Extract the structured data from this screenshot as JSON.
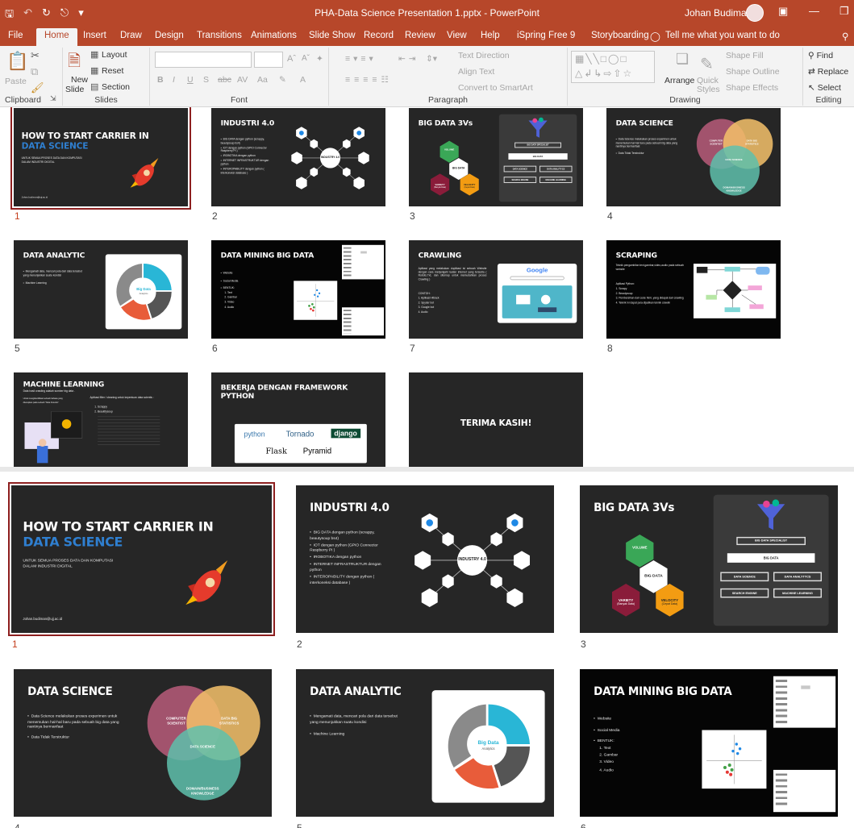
{
  "titlebar": {
    "document_title": "PHA-Data Science Presentation 1.pptx - PowerPoint",
    "user_name": "Johan Budiman",
    "qat_icons": [
      "save-icon",
      "undo-icon",
      "redo-icon",
      "start-from-beginning-icon",
      "customize-qat-icon"
    ]
  },
  "tabs": [
    "File",
    "Home",
    "Insert",
    "Draw",
    "Design",
    "Transitions",
    "Animations",
    "Slide Show",
    "Record",
    "Review",
    "View",
    "Help",
    "iSpring Free 9",
    "Storyboarding"
  ],
  "active_tab": "Home",
  "tell_me": "Tell me what you want to do",
  "ribbon": {
    "clipboard": {
      "label": "Clipboard",
      "paste": "Paste"
    },
    "slides": {
      "label": "Slides",
      "new_slide": "New",
      "new_slide2": "Slide",
      "layout": "Layout",
      "reset": "Reset",
      "section": "Section"
    },
    "font": {
      "label": "Font",
      "bold": "B",
      "italic": "I",
      "underline": "U",
      "shadow": "S",
      "strike": "abc",
      "spacing": "AV",
      "case": "Aa",
      "font_color": "A"
    },
    "paragraph": {
      "label": "Paragraph",
      "text_direction": "Text Direction",
      "align_text": "Align Text",
      "convert": "Convert to SmartArt"
    },
    "drawing": {
      "label": "Drawing",
      "arrange": "Arrange",
      "quick_styles": "Quick",
      "quick_styles2": "Styles",
      "shape_fill": "Shape Fill",
      "shape_outline": "Shape Outline",
      "shape_effects": "Shape Effects"
    },
    "editing": {
      "label": "Editing",
      "find": "Find",
      "replace": "Replace",
      "select": "Select"
    }
  },
  "slides": [
    {
      "n": "1",
      "title1": "HOW TO START CARRIER IN",
      "title2": "DATA SCIENCE",
      "sub1": "UNTUK SEMUA PROSES DATA DAN KOMPUTASI",
      "sub2": "DALAM INDUSTRI DIGITAL",
      "email": "Johan.budiman@ujj.ac.id"
    },
    {
      "n": "2",
      "title": "INDUSTRI 4.0",
      "bullets": [
        "BIG DATA dengan python (scrappy, beautysoup bs4)",
        "IOT dengan python (GPIO Connector Raspberry PI )",
        "IROBOTIKA dengan python",
        "INTERNET INFRASTRUKTUR dengan python",
        "INTEROPABILITY dengan python ( interkoneksi database )"
      ],
      "center": "INDUSTRY 4.0"
    },
    {
      "n": "3",
      "title": "BIG DATA 3Vs",
      "hex": [
        "VOLUME",
        "BIG DATA",
        "VARIETY",
        "VELOCITY"
      ],
      "hex_sub": [
        "",
        "",
        "(Banyak Data)",
        "(Cepat Data)"
      ],
      "boxes": [
        "BIG DATA SPECIALIST",
        "BIG DATA",
        "DATA SCIENCE",
        "DATA ANALYTYCS",
        "SEARCH ENGINE",
        "MACHINE LEARNING"
      ]
    },
    {
      "n": "4",
      "title": "DATA SCIENCE",
      "bullets": [
        "Data Science melakukan proses experimen untuk menemukan hal-hal baru pada sebuah big data yang nantinya bermanfaat",
        "Data Tidak Terstruktur"
      ],
      "venn": [
        "COMPUTER SCIENTIST",
        "DATA BIG STATISTICS",
        "DOMAIN/BUSINESS KNOWLEDGE",
        "DATA SCIENCE"
      ]
    },
    {
      "n": "5",
      "title": "DATA ANALYTIC",
      "bullets": [
        "Mengamati data, mencari pola dari data tersebut yang menunjukkan suatu kondisi",
        "Machine Learning"
      ],
      "donut_center": "Big Data",
      "donut_sub": "Analytics"
    },
    {
      "n": "6",
      "title": "DATA MINING BIG DATA",
      "bullets": [
        "Website",
        "Social Media",
        "BENTUK:"
      ],
      "subitems": [
        "1. Text",
        "2. Gambar",
        "3. Video",
        "4. Audio"
      ]
    },
    {
      "n": "7",
      "title": "CRAWLING",
      "body": "Aplikasi yang melakukan duplikasi isi sebuah Website dengan cara menjelajahi lautan internet yang tersedia ( Robots.Txt, dan sitemap untuk memudahkan proses Crawling )",
      "contoh": "CONTOH:",
      "items": [
        "1. Aplikasi Httrack",
        "2. Spyder bot",
        "3. Google bot",
        "4. Audio"
      ],
      "google": "Google"
    },
    {
      "n": "8",
      "title": "SCRAPING",
      "body": "Teknik pengambilan text,gambar,video,audio pada sebuah website",
      "items": [
        "Aplikasi Python:",
        "1. Scrapy",
        "2. Beautysoup",
        "3. Pembersihan dari code html, yang didapat dari crawling",
        "4. Teknik ini dapat pula dijadikan teknik crawlin"
      ]
    },
    {
      "n": "9",
      "title": "MACHINE LEARNING",
      "sub": "Data hasil crawling adalah sumber big data .",
      "note": "Untuk mengidentifikasi sebuah bahasa yang diterapkan pada sebuah \"Data Scientis\".",
      "right_title": "Aplikasi filter / cleaning  untuk kepentuan data scientis :",
      "items": [
        "1. Scrappy",
        "2. Beautifysoup"
      ]
    },
    {
      "n": "10",
      "title1": "BEKERJA DENGAN FRAMEWORK",
      "title2": "PYTHON",
      "logos": [
        "python",
        "Tornado",
        "django",
        "Flask",
        "Pyramid"
      ]
    },
    {
      "n": "11",
      "title": "TERIMA KASIH!"
    }
  ],
  "colors": {
    "accent": "#b7472a",
    "title_blue": "#2f7fd0",
    "selected_outline": "#8e1f1f"
  }
}
